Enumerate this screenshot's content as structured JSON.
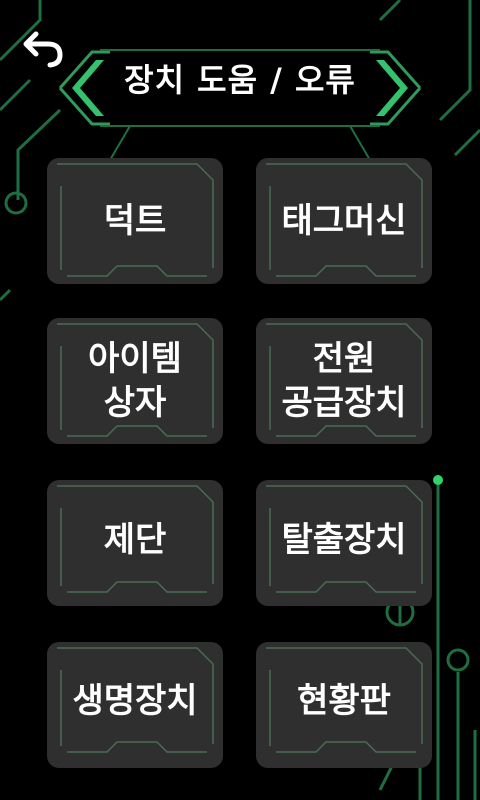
{
  "header": {
    "title": "장치 도움 / 오류",
    "back_icon": "back-arrow-icon"
  },
  "tiles": [
    {
      "label": "덕트"
    },
    {
      "label": "태그머신"
    },
    {
      "label": "아이템\n상자"
    },
    {
      "label": "전원\n공급장치"
    },
    {
      "label": "제단"
    },
    {
      "label": "탈출장치"
    },
    {
      "label": "생명장치"
    },
    {
      "label": "현황판"
    }
  ],
  "colors": {
    "background": "#000000",
    "tile": "#2f2f2f",
    "accent": "#2fd36a",
    "circuit": "#1b6b3f"
  }
}
